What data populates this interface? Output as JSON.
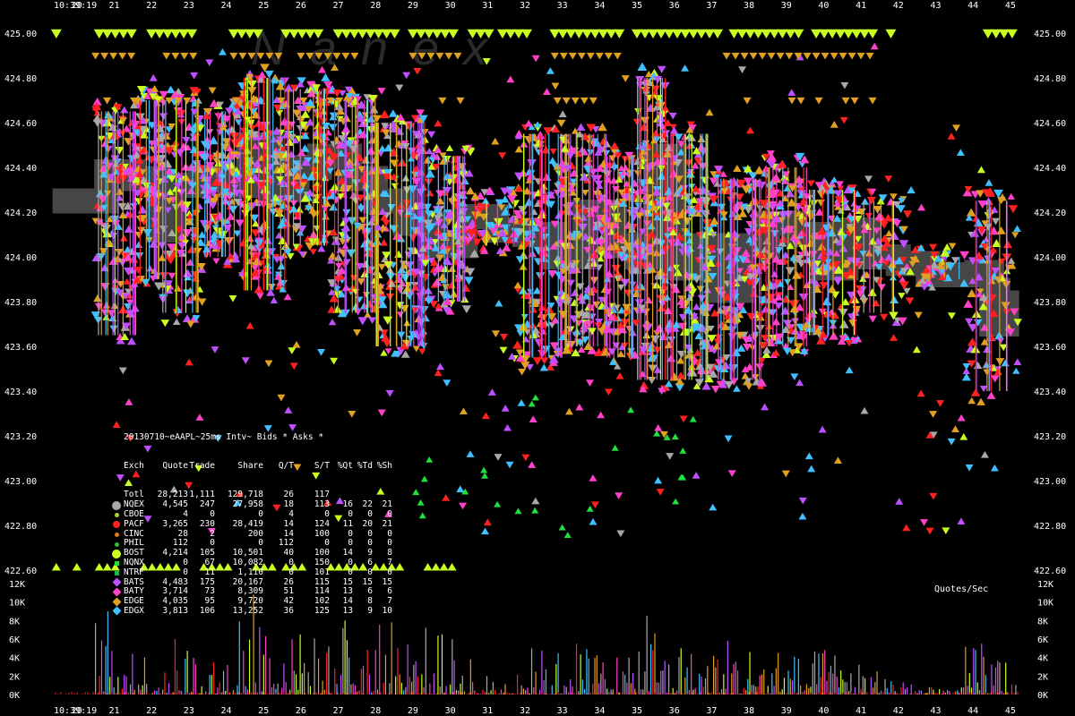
{
  "colors": {
    "background": "#000000",
    "mid": "#464646",
    "NQEX": "#a8a8a8",
    "CBOE": "#a8d830",
    "PACF": "#ff2020",
    "CINC": "#e07818",
    "PHIL": "#30c030",
    "BOST": "#c8ff20",
    "NQNX": "#20e040",
    "NTRF": "#18b848",
    "BATS": "#c050ff",
    "BATY": "#ff40c8",
    "EDGE": "#e0a020",
    "EDGX": "#40c0ff"
  },
  "chart_data": [
    {
      "type": "scatter",
      "time_label": "10:39:19",
      "x_ticks": [
        "20",
        "21",
        "22",
        "23",
        "24",
        "25",
        "26",
        "27",
        "28",
        "29",
        "30",
        "31",
        "32",
        "33",
        "34",
        "35",
        "36",
        "37",
        "38",
        "39",
        "40",
        "41",
        "42",
        "43",
        "44",
        "45"
      ],
      "y_ticks": [
        "425.00",
        "424.80",
        "424.60",
        "424.40",
        "424.20",
        "424.00",
        "423.80",
        "423.60",
        "423.40",
        "423.20",
        "423.00",
        "422.80",
        "422.60"
      ],
      "ylim": [
        422.6,
        425.0
      ],
      "watermark": "N a n e x",
      "legend": {
        "title": "20130710~eAAPL~25ms Intv~ Bids * Asks *",
        "headers": [
          "Exch",
          "Quote",
          "Trade",
          "Share",
          "Q/T",
          "S/T",
          "%Qt",
          "%Td",
          "%Sh"
        ],
        "rows": [
          {
            "exch": "Totl",
            "quote": "28,213",
            "trade": "1,111",
            "share": "129,718",
            "qt": "26",
            "st": "117",
            "pq": "",
            "pt": "",
            "ps": "",
            "color": "",
            "shape": "none"
          },
          {
            "exch": "NQEX",
            "quote": "4,545",
            "trade": "247",
            "share": "27,958",
            "qt": "18",
            "st": "113",
            "pq": "16",
            "pt": "22",
            "ps": "21",
            "color": "NQEX",
            "shape": "circle-lg"
          },
          {
            "exch": "CBOE",
            "quote": "4",
            "trade": "0",
            "share": "0",
            "qt": "4",
            "st": "0",
            "pq": "0",
            "pt": "0",
            "ps": "0",
            "color": "CBOE",
            "shape": "circle-sm"
          },
          {
            "exch": "PACF",
            "quote": "3,265",
            "trade": "230",
            "share": "28,419",
            "qt": "14",
            "st": "124",
            "pq": "11",
            "pt": "20",
            "ps": "21",
            "color": "PACF",
            "shape": "circle"
          },
          {
            "exch": "CINC",
            "quote": "28",
            "trade": "2",
            "share": "200",
            "qt": "14",
            "st": "100",
            "pq": "0",
            "pt": "0",
            "ps": "0",
            "color": "CINC",
            "shape": "circle-sm"
          },
          {
            "exch": "PHIL",
            "quote": "112",
            "trade": "0",
            "share": "0",
            "qt": "112",
            "st": "0",
            "pq": "0",
            "pt": "0",
            "ps": "0",
            "color": "PHIL",
            "shape": "circle-sm"
          },
          {
            "exch": "BOST",
            "quote": "4,214",
            "trade": "105",
            "share": "10,501",
            "qt": "40",
            "st": "100",
            "pq": "14",
            "pt": "9",
            "ps": "8",
            "color": "BOST",
            "shape": "circle-lg"
          },
          {
            "exch": "NQNX",
            "quote": "0",
            "trade": "67",
            "share": "10,082",
            "qt": "0",
            "st": "150",
            "pq": "0",
            "pt": "6",
            "ps": "7",
            "color": "NQNX",
            "shape": "square"
          },
          {
            "exch": "NTRF",
            "quote": "0",
            "trade": "11",
            "share": "1,110",
            "qt": "0",
            "st": "101",
            "pq": "0",
            "pt": "0",
            "ps": "0",
            "color": "NTRF",
            "shape": "square"
          },
          {
            "exch": "BATS",
            "quote": "4,483",
            "trade": "175",
            "share": "20,167",
            "qt": "26",
            "st": "115",
            "pq": "15",
            "pt": "15",
            "ps": "15",
            "color": "BATS",
            "shape": "diamond"
          },
          {
            "exch": "BATY",
            "quote": "3,714",
            "trade": "73",
            "share": "8,309",
            "qt": "51",
            "st": "114",
            "pq": "13",
            "pt": "6",
            "ps": "6",
            "color": "BATY",
            "shape": "diamond"
          },
          {
            "exch": "EDGE",
            "quote": "4,035",
            "trade": "95",
            "share": "9,720",
            "qt": "42",
            "st": "102",
            "pq": "14",
            "pt": "8",
            "ps": "7",
            "color": "EDGE",
            "shape": "diamond"
          },
          {
            "exch": "EDGX",
            "quote": "3,813",
            "trade": "106",
            "share": "13,252",
            "qt": "36",
            "st": "125",
            "pq": "13",
            "pt": "9",
            "ps": "10",
            "color": "EDGX",
            "shape": "diamond"
          }
        ]
      },
      "mid_band": [
        {
          "x": 19.35,
          "y": 424.25
        },
        {
          "x": 20.5,
          "y": 424.25
        },
        {
          "x": 20.8,
          "y": 424.38
        },
        {
          "x": 21.5,
          "y": 424.35
        },
        {
          "x": 22.2,
          "y": 424.12
        },
        {
          "x": 22.6,
          "y": 424.32
        },
        {
          "x": 23.3,
          "y": 424.35
        },
        {
          "x": 24.1,
          "y": 424.32
        },
        {
          "x": 24.6,
          "y": 424.5
        },
        {
          "x": 25.2,
          "y": 424.3
        },
        {
          "x": 25.9,
          "y": 424.4
        },
        {
          "x": 26.5,
          "y": 424.45
        },
        {
          "x": 27.3,
          "y": 424.35
        },
        {
          "x": 28.0,
          "y": 424.25
        },
        {
          "x": 28.8,
          "y": 424.15
        },
        {
          "x": 29.6,
          "y": 424.05
        },
        {
          "x": 30.4,
          "y": 424.18
        },
        {
          "x": 31.2,
          "y": 424.12
        },
        {
          "x": 32.0,
          "y": 424.1
        },
        {
          "x": 32.8,
          "y": 424.0
        },
        {
          "x": 33.6,
          "y": 424.2
        },
        {
          "x": 34.4,
          "y": 424.05
        },
        {
          "x": 35.0,
          "y": 424.0
        },
        {
          "x": 35.5,
          "y": 424.45
        },
        {
          "x": 36.0,
          "y": 423.95
        },
        {
          "x": 36.6,
          "y": 424.05
        },
        {
          "x": 37.2,
          "y": 423.85
        },
        {
          "x": 37.8,
          "y": 424.05
        },
        {
          "x": 38.5,
          "y": 424.15
        },
        {
          "x": 39.2,
          "y": 424.1
        },
        {
          "x": 40.0,
          "y": 423.95
        },
        {
          "x": 40.6,
          "y": 424.12
        },
        {
          "x": 41.2,
          "y": 424.0
        },
        {
          "x": 42.0,
          "y": 423.97
        },
        {
          "x": 42.8,
          "y": 423.92
        },
        {
          "x": 43.6,
          "y": 423.92
        },
        {
          "x": 44.1,
          "y": 423.93
        },
        {
          "x": 44.5,
          "y": 423.7
        },
        {
          "x": 44.9,
          "y": 423.85
        }
      ],
      "activity_segments": [
        {
          "x0": 20.5,
          "x1": 21.6,
          "lo": 423.6,
          "hi": 424.7,
          "n": 160
        },
        {
          "x0": 21.6,
          "x1": 22.3,
          "lo": 423.85,
          "hi": 424.75,
          "n": 110
        },
        {
          "x0": 22.3,
          "x1": 23.4,
          "lo": 423.7,
          "hi": 424.75,
          "n": 150
        },
        {
          "x0": 23.4,
          "x1": 24.4,
          "lo": 423.95,
          "hi": 424.7,
          "n": 140
        },
        {
          "x0": 24.4,
          "x1": 25.6,
          "lo": 423.8,
          "hi": 424.85,
          "n": 190
        },
        {
          "x0": 25.6,
          "x1": 26.8,
          "lo": 424.0,
          "hi": 424.8,
          "n": 150
        },
        {
          "x0": 26.8,
          "x1": 28.0,
          "lo": 423.7,
          "hi": 424.75,
          "n": 190
        },
        {
          "x0": 28.0,
          "x1": 29.4,
          "lo": 423.55,
          "hi": 424.65,
          "n": 200
        },
        {
          "x0": 29.4,
          "x1": 30.6,
          "lo": 423.75,
          "hi": 424.5,
          "n": 150
        },
        {
          "x0": 30.6,
          "x1": 31.8,
          "lo": 424.0,
          "hi": 424.3,
          "n": 60
        },
        {
          "x0": 31.8,
          "x1": 33.0,
          "lo": 423.5,
          "hi": 424.6,
          "n": 170
        },
        {
          "x0": 33.0,
          "x1": 34.2,
          "lo": 423.55,
          "hi": 424.6,
          "n": 190
        },
        {
          "x0": 34.2,
          "x1": 35.0,
          "lo": 423.5,
          "hi": 424.5,
          "n": 130
        },
        {
          "x0": 35.0,
          "x1": 35.8,
          "lo": 423.4,
          "hi": 424.85,
          "n": 170
        },
        {
          "x0": 35.8,
          "x1": 37.0,
          "lo": 423.4,
          "hi": 424.6,
          "n": 190
        },
        {
          "x0": 37.0,
          "x1": 38.4,
          "lo": 423.4,
          "hi": 424.4,
          "n": 200
        },
        {
          "x0": 38.4,
          "x1": 39.6,
          "lo": 423.55,
          "hi": 424.45,
          "n": 170
        },
        {
          "x0": 39.6,
          "x1": 41.0,
          "lo": 423.6,
          "hi": 424.35,
          "n": 160
        },
        {
          "x0": 41.0,
          "x1": 42.4,
          "lo": 423.7,
          "hi": 424.3,
          "n": 80
        },
        {
          "x0": 42.4,
          "x1": 43.8,
          "lo": 423.85,
          "hi": 424.05,
          "n": 40
        },
        {
          "x0": 43.8,
          "x1": 45.2,
          "lo": 423.35,
          "hi": 424.3,
          "n": 110
        }
      ],
      "top_marker_runs": [
        [
          19.45,
          19.6
        ],
        [
          20.6,
          21.6
        ],
        [
          22.0,
          23.2
        ],
        [
          24.2,
          25.0
        ],
        [
          25.6,
          26.6
        ],
        [
          27.0,
          28.6
        ],
        [
          29.0,
          30.2
        ],
        [
          30.6,
          31.2
        ],
        [
          31.4,
          32.2
        ],
        [
          32.8,
          34.6
        ],
        [
          35.0,
          37.2
        ],
        [
          37.6,
          39.4
        ],
        [
          39.8,
          41.4
        ],
        [
          41.8,
          42.0
        ],
        [
          44.4,
          45.2
        ]
      ],
      "bottom_marker_runs": [
        [
          19.45,
          19.6
        ],
        [
          20.0,
          20.2
        ],
        [
          20.6,
          21.2
        ],
        [
          21.8,
          22.8
        ],
        [
          23.4,
          24.2
        ],
        [
          24.8,
          25.4
        ],
        [
          25.6,
          26.2
        ],
        [
          26.8,
          27.8
        ],
        [
          28.0,
          28.8
        ],
        [
          29.4,
          30.2
        ]
      ]
    },
    {
      "type": "bar",
      "title": "Quotes/Sec",
      "y_ticks": [
        "12K",
        "10K",
        "8K",
        "6K",
        "4K",
        "2K",
        "0K"
      ],
      "ylim": [
        0,
        12000
      ],
      "bursts": [
        {
          "x0": 20.5,
          "x1": 21.6,
          "peak": 9000
        },
        {
          "x0": 21.6,
          "x1": 22.3,
          "peak": 4000
        },
        {
          "x0": 22.3,
          "x1": 23.4,
          "peak": 6000
        },
        {
          "x0": 23.4,
          "x1": 24.3,
          "peak": 3500
        },
        {
          "x0": 24.3,
          "x1": 25.6,
          "peak": 10800
        },
        {
          "x0": 25.6,
          "x1": 26.8,
          "peak": 6500
        },
        {
          "x0": 26.8,
          "x1": 28.0,
          "peak": 8000
        },
        {
          "x0": 28.0,
          "x1": 29.4,
          "peak": 7800
        },
        {
          "x0": 29.4,
          "x1": 30.6,
          "peak": 6500
        },
        {
          "x0": 30.6,
          "x1": 31.8,
          "peak": 2000
        },
        {
          "x0": 31.8,
          "x1": 33.0,
          "peak": 5000
        },
        {
          "x0": 33.0,
          "x1": 34.2,
          "peak": 5500
        },
        {
          "x0": 34.2,
          "x1": 35.0,
          "peak": 4000
        },
        {
          "x0": 35.0,
          "x1": 35.8,
          "peak": 8500
        },
        {
          "x0": 35.8,
          "x1": 37.0,
          "peak": 5000
        },
        {
          "x0": 37.0,
          "x1": 38.4,
          "peak": 5800
        },
        {
          "x0": 38.4,
          "x1": 39.6,
          "peak": 4500
        },
        {
          "x0": 39.6,
          "x1": 41.0,
          "peak": 4800
        },
        {
          "x0": 41.0,
          "x1": 42.4,
          "peak": 2500
        },
        {
          "x0": 42.4,
          "x1": 43.8,
          "peak": 800
        },
        {
          "x0": 43.8,
          "x1": 45.2,
          "peak": 5500
        }
      ]
    }
  ]
}
